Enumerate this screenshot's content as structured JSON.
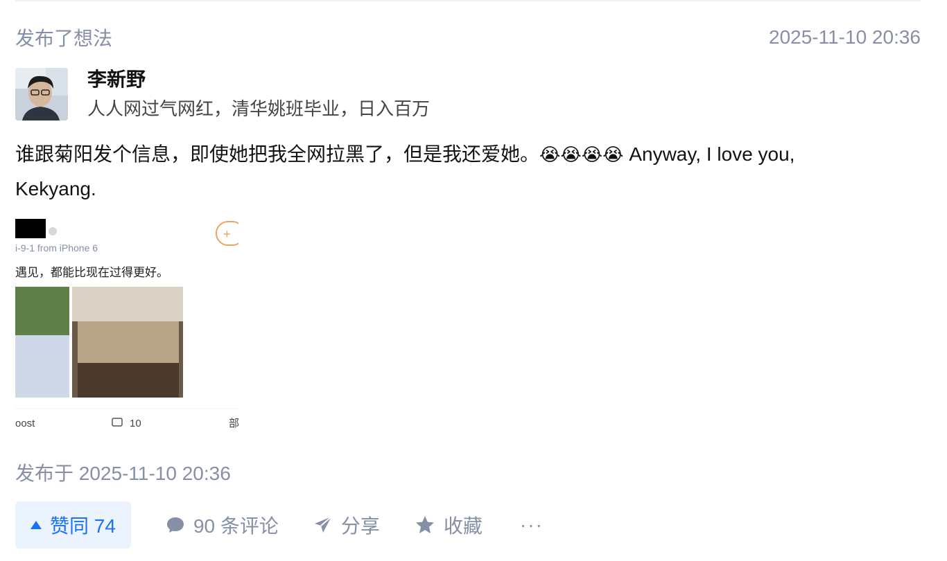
{
  "header": {
    "action": "发布了想法",
    "time": "2025-11-10 20:36"
  },
  "author": {
    "name": "李新野",
    "bio": "人人网过气网红，清华姚班毕业，日入百万"
  },
  "post": {
    "text_cn": "谁跟菊阳发个信息，即使她把我全网拉黑了，但是我还爱她。",
    "emojis": "😭😭😭😭",
    "text_en": " Anyway, I love you,",
    "text_en_2": "Kekyang.",
    "image": {
      "meta": "i-9-1  from iPhone 6",
      "caption": "遇见，都能比现在过得更好。",
      "footer_left": "oost",
      "footer_count": "10",
      "footer_right": "部"
    }
  },
  "published": "发布于 2025-11-10 20:36",
  "actions": {
    "vote": "赞同 74",
    "comments": "90 条评论",
    "share": "分享",
    "favorite": "收藏",
    "more": "···"
  },
  "colors": {
    "accent": "#1772f6",
    "muted": "#8590a6",
    "vote_bg": "#ebf3ff"
  }
}
